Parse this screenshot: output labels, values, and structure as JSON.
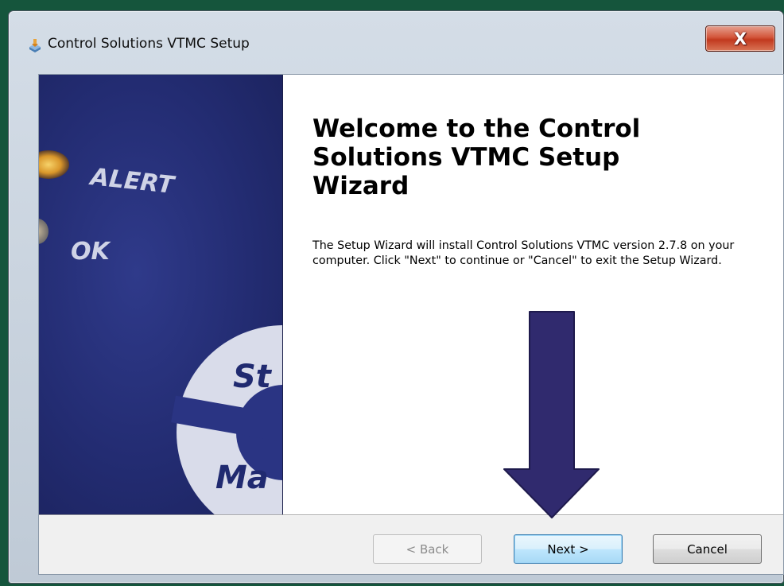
{
  "window": {
    "title": "Control Solutions VTMC Setup",
    "close_label": "X"
  },
  "side_panel": {
    "labels": [
      "ALERT",
      "OK",
      "St",
      "Ma"
    ]
  },
  "content": {
    "heading": "Welcome to the Control Solutions VTMC Setup Wizard",
    "description": "The Setup Wizard will install Control Solutions VTMC version 2.7.8 on your computer.  Click \"Next\" to continue or \"Cancel\" to exit the Setup Wizard."
  },
  "buttons": {
    "back": "< Back",
    "next": "Next >",
    "cancel": "Cancel"
  },
  "colors": {
    "background": "#15553c",
    "annotation_arrow": "#302a6e",
    "panel_blue": "#232c72"
  },
  "icons": {
    "title": "installer-icon",
    "close": "close-icon",
    "annotation": "down-arrow-icon"
  }
}
